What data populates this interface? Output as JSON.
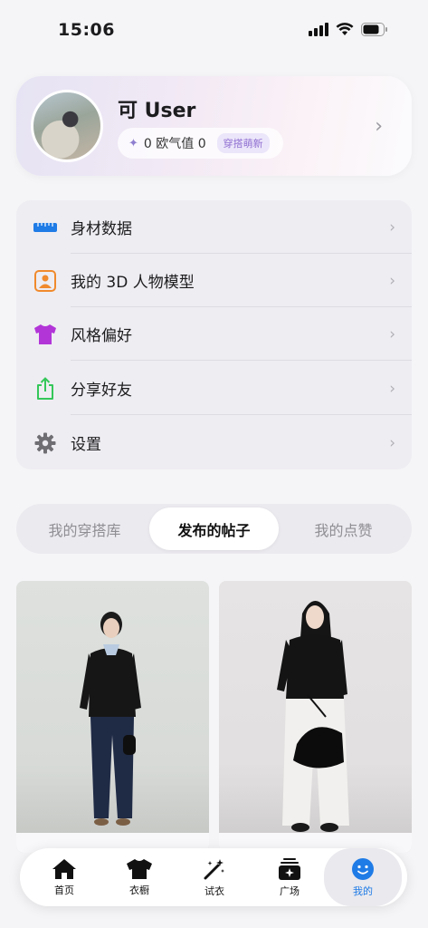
{
  "status": {
    "time": "15:06"
  },
  "profile": {
    "name": "可 User",
    "oq_text": "0 欧气值 0",
    "badge": "穿搭萌新"
  },
  "menu": [
    {
      "label": "身材数据",
      "icon": "ruler-icon",
      "color": "#1f7be6"
    },
    {
      "label": "我的 3D 人物模型",
      "icon": "person-scan-icon",
      "color": "#f08a2c"
    },
    {
      "label": "风格偏好",
      "icon": "tshirt-icon",
      "color": "#b235d8"
    },
    {
      "label": "分享好友",
      "icon": "share-icon",
      "color": "#34c759"
    },
    {
      "label": "设置",
      "icon": "gear-icon",
      "color": "#6e6e73"
    }
  ],
  "tabs": [
    {
      "label": "我的穿搭库",
      "active": false
    },
    {
      "label": "发布的帖子",
      "active": true
    },
    {
      "label": "我的点赞",
      "active": false
    }
  ],
  "posts": [
    {
      "image": "woman-black-cardigan-jeans-photo"
    },
    {
      "image": "woman-black-cardigan-white-pants-bag-photo"
    }
  ],
  "tab_bar": [
    {
      "label": "首页",
      "icon": "home-icon",
      "active": false
    },
    {
      "label": "衣橱",
      "icon": "wardrobe-shirt-icon",
      "active": false
    },
    {
      "label": "试衣",
      "icon": "magic-wand-icon",
      "active": false
    },
    {
      "label": "广场",
      "icon": "plaza-icon",
      "active": false
    },
    {
      "label": "我的",
      "icon": "smiley-icon",
      "active": true
    }
  ],
  "colors": {
    "accent": "#1f7be6",
    "badge": "#8f6fd1"
  }
}
